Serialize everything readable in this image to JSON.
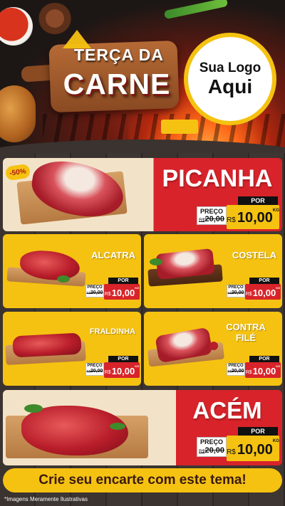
{
  "header": {
    "title_line1": "TERÇA DA",
    "title_line2": "CARNE",
    "logo_line1": "Sua Logo",
    "logo_line2": "Aqui"
  },
  "products": {
    "picanha": {
      "name": "PICANHA",
      "badge": "-50%",
      "por": "POR",
      "preco_label": "PREÇO",
      "old_currency": "R$",
      "old_value": "20,00",
      "currency": "R$",
      "price": "10,00",
      "unit": "KG"
    },
    "alcatra": {
      "name": "ALCATRA",
      "por": "POR",
      "preco_label": "PREÇO",
      "old_currency": "R$",
      "old_value": "20,00",
      "currency": "R$",
      "price": "10,00",
      "unit": "KG"
    },
    "costela": {
      "name": "COSTELA",
      "por": "POR",
      "preco_label": "PREÇO",
      "old_currency": "R$",
      "old_value": "20,00",
      "currency": "R$",
      "price": "10,00",
      "unit": "KG"
    },
    "fraldinha": {
      "name": "FRALDINHA",
      "por": "POR",
      "preco_label": "PREÇO",
      "old_currency": "R$",
      "old_value": "20,00",
      "currency": "R$",
      "price": "10,00",
      "unit": "KG"
    },
    "contra_file": {
      "name_line1": "CONTRA",
      "name_line2": "FILÉ",
      "por": "POR",
      "preco_label": "PREÇO",
      "old_currency": "R$",
      "old_value": "20,00",
      "currency": "R$",
      "price": "10,00",
      "unit": "KG"
    },
    "acem": {
      "name": "ACÉM",
      "por": "POR",
      "preco_label": "PREÇO",
      "old_currency": "R$",
      "old_value": "20,00",
      "currency": "R$",
      "price": "10,00",
      "unit": "KG"
    }
  },
  "banner": "Crie seu encarte com este tema!",
  "footnote": "*Imagens Meramente Ilustrativas",
  "colors": {
    "red": "#d8232a",
    "yellow": "#f5c211",
    "dark": "#111111",
    "wood": "#3a3330"
  }
}
